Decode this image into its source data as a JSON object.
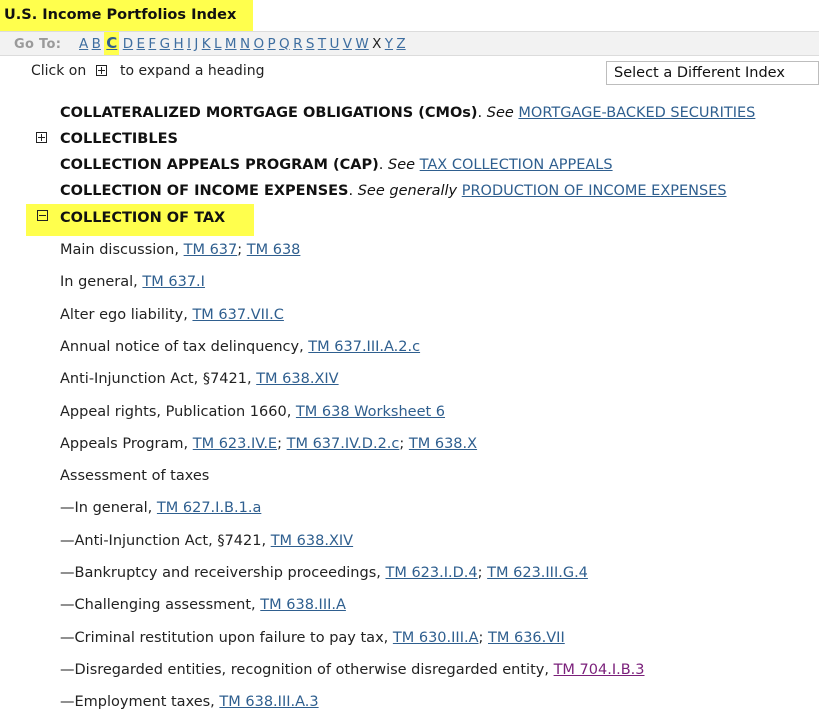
{
  "header": {
    "title": "U.S. Income Portfolios Index"
  },
  "goto": {
    "label": "Go To:",
    "letters": [
      {
        "t": "A",
        "state": "link"
      },
      {
        "t": "B",
        "state": "link"
      },
      {
        "t": "C",
        "state": "current"
      },
      {
        "t": "D",
        "state": "link"
      },
      {
        "t": "E",
        "state": "link"
      },
      {
        "t": "F",
        "state": "link"
      },
      {
        "t": "G",
        "state": "link"
      },
      {
        "t": "H",
        "state": "link"
      },
      {
        "t": "I",
        "state": "link"
      },
      {
        "t": "J",
        "state": "link"
      },
      {
        "t": "K",
        "state": "link"
      },
      {
        "t": "L",
        "state": "link"
      },
      {
        "t": "M",
        "state": "link"
      },
      {
        "t": "N",
        "state": "link"
      },
      {
        "t": "O",
        "state": "link"
      },
      {
        "t": "P",
        "state": "link"
      },
      {
        "t": "Q",
        "state": "link"
      },
      {
        "t": "R",
        "state": "link"
      },
      {
        "t": "S",
        "state": "link"
      },
      {
        "t": "T",
        "state": "link"
      },
      {
        "t": "U",
        "state": "link"
      },
      {
        "t": "V",
        "state": "link"
      },
      {
        "t": "W",
        "state": "link"
      },
      {
        "t": "X",
        "state": "disabled"
      },
      {
        "t": "Y",
        "state": "link"
      },
      {
        "t": "Z",
        "state": "link"
      }
    ]
  },
  "hint": {
    "before": "Click on",
    "after": "to expand a heading",
    "icon": "plus-box-icon"
  },
  "index_select": {
    "value": "Select a Different Index"
  },
  "entries": [
    {
      "heading": "COLLATERALIZED MORTGAGE OBLIGATIONS (CMOs)",
      "see": "See",
      "link": "MORTGAGE-BACKED SECURITIES"
    },
    {
      "heading": "COLLECTIBLES"
    },
    {
      "heading": "COLLECTION APPEALS PROGRAM (CAP)",
      "see": "See",
      "link": "TAX COLLECTION APPEALS"
    },
    {
      "heading": "COLLECTION OF INCOME EXPENSES",
      "see": "See generally",
      "link": "PRODUCTION OF INCOME EXPENSES"
    }
  ],
  "expanded_heading": "COLLECTION OF TAX",
  "subentries": [
    {
      "text": "Main discussion, ",
      "refs": [
        "TM 637",
        "TM 638"
      ]
    },
    {
      "text": "In general, ",
      "refs": [
        "TM 637.I"
      ]
    },
    {
      "text": "Alter ego liability, ",
      "refs": [
        "TM 637.VII.C"
      ]
    },
    {
      "text": "Annual notice of tax delinquency, ",
      "refs": [
        "TM 637.III.A.2.c"
      ]
    },
    {
      "text": "Anti-Injunction Act, §7421, ",
      "refs": [
        "TM 638.XIV"
      ]
    },
    {
      "text": "Appeal rights, Publication 1660, ",
      "refs": [
        "TM 638 Worksheet 6"
      ]
    },
    {
      "text": "Appeals Program, ",
      "refs": [
        "TM 623.IV.E",
        "TM 637.IV.D.2.c",
        "TM 638.X"
      ]
    },
    {
      "text": "Assessment of taxes",
      "refs": []
    },
    {
      "text": "—In general, ",
      "refs": [
        "TM 627.I.B.1.a"
      ]
    },
    {
      "text": "—Anti-Injunction Act, §7421, ",
      "refs": [
        "TM 638.XIV"
      ]
    },
    {
      "text": "—Bankruptcy and receivership proceedings, ",
      "refs": [
        "TM 623.I.D.4",
        "TM 623.III.G.4"
      ]
    },
    {
      "text": "—Challenging assessment, ",
      "refs": [
        "TM 638.III.A"
      ]
    },
    {
      "text": "—Criminal restitution upon failure to pay tax, ",
      "refs": [
        "TM 630.III.A",
        "TM 636.VII"
      ]
    },
    {
      "text": "—Disregarded entities, recognition of otherwise disregarded entity, ",
      "refs": [
        "TM 704.I.B.3"
      ],
      "visited": true
    },
    {
      "text": "—Employment taxes, ",
      "refs": [
        "TM 638.III.A.3"
      ]
    }
  ],
  "colors": {
    "highlight": "#ffff4d",
    "link": "#2f5f8f",
    "visited": "#7a1f7a"
  }
}
